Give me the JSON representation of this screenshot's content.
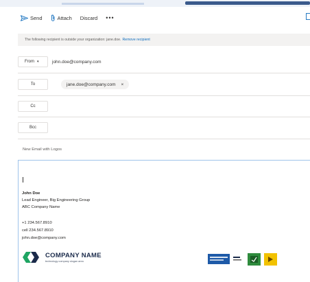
{
  "toolbar": {
    "send_label": "Send",
    "attach_label": "Attach",
    "discard_label": "Discard",
    "more_label": "•••"
  },
  "banner": {
    "text": "The following recipient is outside your organization: jane.doe.",
    "link": "Remove recipient"
  },
  "from": {
    "label": "From",
    "value": "john.doe@company.com"
  },
  "to": {
    "label": "To",
    "recipient": "jane.doe@company.com",
    "remove_glyph": "×"
  },
  "cc": {
    "label": "Cc"
  },
  "bcc": {
    "label": "Bcc"
  },
  "subject": {
    "value": "New Email with Logos"
  },
  "signature": {
    "name": "John Doe",
    "title": "Lead Engineer, Big Engineering Group",
    "company": "ABC Company Name",
    "phone": "+1 234.567.8910",
    "cell": "cell 234.567.8910",
    "email": "john.doe@company.com"
  },
  "logo": {
    "name": "COMPANY NAME",
    "tagline": "technology company slogan area"
  },
  "colors": {
    "accent": "#0f6cbd",
    "logo_green": "#1fa563",
    "logo_navy": "#1a2a4a",
    "badge_blue": "#1e5aa8",
    "badge_green": "#2e8b3d",
    "badge_yellow": "#f2c200"
  }
}
